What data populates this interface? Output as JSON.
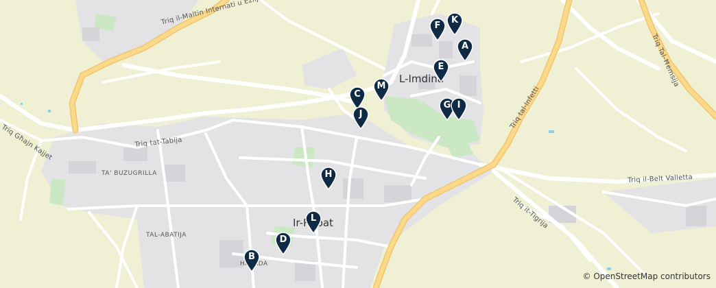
{
  "map": {
    "place_labels": [
      "L-Imdina",
      "Ir-Rabat",
      "TA' BUZUGRILLA",
      "TAL-ABATIJA",
      "HAJJADA"
    ],
    "road_labels": [
      "Triq il-Maltin Internati u Eżiljati",
      "Triq Għajn Kajjet",
      "Triq tat-Tabija",
      "Triq tal-Infetti",
      "Triq Tal-Ħemsija",
      "Triq il-Belt Valletta",
      "Triq it-Tigrija"
    ],
    "markers": [
      "A",
      "B",
      "C",
      "D",
      "E",
      "F",
      "G",
      "H",
      "I",
      "J",
      "K",
      "L",
      "M"
    ],
    "marker_color": "#0f2a44",
    "attribution": "© OpenStreetMap contributors"
  }
}
